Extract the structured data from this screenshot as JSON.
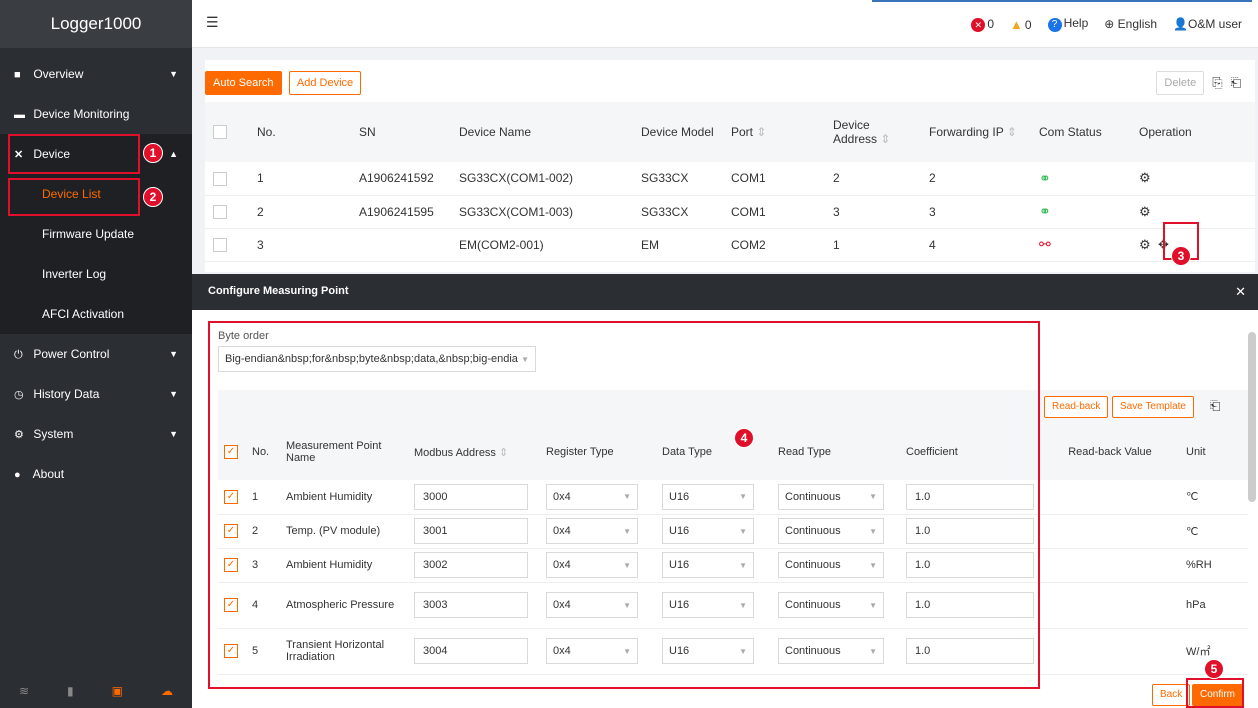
{
  "app": {
    "title": "Logger1000"
  },
  "topbar": {
    "errors": "0",
    "warnings": "0",
    "help": "Help",
    "language": "English",
    "user": "O&M user"
  },
  "sidebar": {
    "items": [
      {
        "label": "Overview",
        "icon": "grid-icon",
        "expanded": false
      },
      {
        "label": "Device Monitoring",
        "icon": "monitor-icon"
      },
      {
        "label": "Device",
        "icon": "wrench-icon",
        "expanded": true
      },
      {
        "label": "Power Control",
        "icon": "power-icon"
      },
      {
        "label": "History Data",
        "icon": "clock-icon"
      },
      {
        "label": "System",
        "icon": "gear-icon"
      },
      {
        "label": "About",
        "icon": "info-icon"
      }
    ],
    "device_sub": [
      "Device List",
      "Firmware Update",
      "Inverter Log",
      "AFCI Activation"
    ],
    "bottom_icons": [
      "wifi-icon",
      "signal-icon",
      "device-icon",
      "cloud-icon"
    ]
  },
  "device_panel": {
    "buttons": {
      "auto_search": "Auto Search",
      "add_device": "Add Device",
      "delete": "Delete"
    },
    "columns": [
      "No.",
      "SN",
      "Device Name",
      "Device Model",
      "Port",
      "Device Address",
      "Forwarding IP",
      "Com Status",
      "Operation"
    ],
    "rows": [
      {
        "no": "1",
        "sn": "A1906241592",
        "name": "SG33CX(COM1-002)",
        "model": "SG33CX",
        "port": "COM1",
        "address": "2",
        "fwd_ip": "2",
        "status": "ok"
      },
      {
        "no": "2",
        "sn": "A1906241595",
        "name": "SG33CX(COM1-003)",
        "model": "SG33CX",
        "port": "COM1",
        "address": "3",
        "fwd_ip": "3",
        "status": "ok"
      },
      {
        "no": "3",
        "sn": "",
        "name": "EM(COM2-001)",
        "model": "EM",
        "port": "COM2",
        "address": "1",
        "fwd_ip": "4",
        "status": "fail"
      }
    ]
  },
  "modal": {
    "title": "Configure Measuring Point",
    "byte_order_label": "Byte order",
    "byte_order_value": "Big-endian&nbsp;for&nbsp;byte&nbsp;data,&nbsp;big-endia",
    "buttons": {
      "read_back": "Read-back",
      "save_template": "Save Template",
      "back": "Back",
      "confirm": "Confirm"
    },
    "columns": [
      "No.",
      "Measurement Point Name",
      "Modbus Address",
      "Register Type",
      "Data Type",
      "Read Type",
      "Coefficient",
      "Read-back Value",
      "Unit"
    ],
    "rows": [
      {
        "no": "1",
        "name": "Ambient Humidity",
        "address": "3000",
        "reg": "0x4",
        "dtype": "U16",
        "rtype": "Continuous",
        "coef": "1.0",
        "readback": "",
        "unit": "℃"
      },
      {
        "no": "2",
        "name": "Temp. (PV module)",
        "address": "3001",
        "reg": "0x4",
        "dtype": "U16",
        "rtype": "Continuous",
        "coef": "1.0",
        "readback": "",
        "unit": "℃"
      },
      {
        "no": "3",
        "name": "Ambient Humidity",
        "address": "3002",
        "reg": "0x4",
        "dtype": "U16",
        "rtype": "Continuous",
        "coef": "1.0",
        "readback": "",
        "unit": "%RH"
      },
      {
        "no": "4",
        "name": "Atmospheric Pressure",
        "address": "3003",
        "reg": "0x4",
        "dtype": "U16",
        "rtype": "Continuous",
        "coef": "1.0",
        "readback": "",
        "unit": "hPa"
      },
      {
        "no": "5",
        "name": "Transient Horizontal Irradiation",
        "address": "3004",
        "reg": "0x4",
        "dtype": "U16",
        "rtype": "Continuous",
        "coef": "1.0",
        "readback": "",
        "unit": "W/㎡"
      }
    ]
  },
  "callouts": [
    "1",
    "2",
    "3",
    "4",
    "5"
  ],
  "colors": {
    "accent": "#ff6a00",
    "sidebar": "#2b2e33",
    "highlight": "#e1102a",
    "ok": "#2db84d",
    "fail": "#e1102a"
  }
}
